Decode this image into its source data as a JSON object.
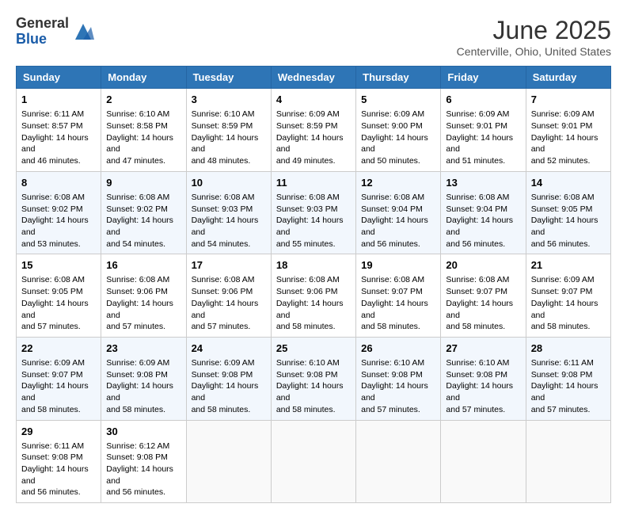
{
  "logo": {
    "general": "General",
    "blue": "Blue"
  },
  "title": "June 2025",
  "location": "Centerville, Ohio, United States",
  "weekdays": [
    "Sunday",
    "Monday",
    "Tuesday",
    "Wednesday",
    "Thursday",
    "Friday",
    "Saturday"
  ],
  "weeks": [
    [
      {
        "day": "1",
        "sunrise": "6:11 AM",
        "sunset": "8:57 PM",
        "daylight": "14 hours and 46 minutes."
      },
      {
        "day": "2",
        "sunrise": "6:10 AM",
        "sunset": "8:58 PM",
        "daylight": "14 hours and 47 minutes."
      },
      {
        "day": "3",
        "sunrise": "6:10 AM",
        "sunset": "8:59 PM",
        "daylight": "14 hours and 48 minutes."
      },
      {
        "day": "4",
        "sunrise": "6:09 AM",
        "sunset": "8:59 PM",
        "daylight": "14 hours and 49 minutes."
      },
      {
        "day": "5",
        "sunrise": "6:09 AM",
        "sunset": "9:00 PM",
        "daylight": "14 hours and 50 minutes."
      },
      {
        "day": "6",
        "sunrise": "6:09 AM",
        "sunset": "9:01 PM",
        "daylight": "14 hours and 51 minutes."
      },
      {
        "day": "7",
        "sunrise": "6:09 AM",
        "sunset": "9:01 PM",
        "daylight": "14 hours and 52 minutes."
      }
    ],
    [
      {
        "day": "8",
        "sunrise": "6:08 AM",
        "sunset": "9:02 PM",
        "daylight": "14 hours and 53 minutes."
      },
      {
        "day": "9",
        "sunrise": "6:08 AM",
        "sunset": "9:02 PM",
        "daylight": "14 hours and 54 minutes."
      },
      {
        "day": "10",
        "sunrise": "6:08 AM",
        "sunset": "9:03 PM",
        "daylight": "14 hours and 54 minutes."
      },
      {
        "day": "11",
        "sunrise": "6:08 AM",
        "sunset": "9:03 PM",
        "daylight": "14 hours and 55 minutes."
      },
      {
        "day": "12",
        "sunrise": "6:08 AM",
        "sunset": "9:04 PM",
        "daylight": "14 hours and 56 minutes."
      },
      {
        "day": "13",
        "sunrise": "6:08 AM",
        "sunset": "9:04 PM",
        "daylight": "14 hours and 56 minutes."
      },
      {
        "day": "14",
        "sunrise": "6:08 AM",
        "sunset": "9:05 PM",
        "daylight": "14 hours and 56 minutes."
      }
    ],
    [
      {
        "day": "15",
        "sunrise": "6:08 AM",
        "sunset": "9:05 PM",
        "daylight": "14 hours and 57 minutes."
      },
      {
        "day": "16",
        "sunrise": "6:08 AM",
        "sunset": "9:06 PM",
        "daylight": "14 hours and 57 minutes."
      },
      {
        "day": "17",
        "sunrise": "6:08 AM",
        "sunset": "9:06 PM",
        "daylight": "14 hours and 57 minutes."
      },
      {
        "day": "18",
        "sunrise": "6:08 AM",
        "sunset": "9:06 PM",
        "daylight": "14 hours and 58 minutes."
      },
      {
        "day": "19",
        "sunrise": "6:08 AM",
        "sunset": "9:07 PM",
        "daylight": "14 hours and 58 minutes."
      },
      {
        "day": "20",
        "sunrise": "6:08 AM",
        "sunset": "9:07 PM",
        "daylight": "14 hours and 58 minutes."
      },
      {
        "day": "21",
        "sunrise": "6:09 AM",
        "sunset": "9:07 PM",
        "daylight": "14 hours and 58 minutes."
      }
    ],
    [
      {
        "day": "22",
        "sunrise": "6:09 AM",
        "sunset": "9:07 PM",
        "daylight": "14 hours and 58 minutes."
      },
      {
        "day": "23",
        "sunrise": "6:09 AM",
        "sunset": "9:08 PM",
        "daylight": "14 hours and 58 minutes."
      },
      {
        "day": "24",
        "sunrise": "6:09 AM",
        "sunset": "9:08 PM",
        "daylight": "14 hours and 58 minutes."
      },
      {
        "day": "25",
        "sunrise": "6:10 AM",
        "sunset": "9:08 PM",
        "daylight": "14 hours and 58 minutes."
      },
      {
        "day": "26",
        "sunrise": "6:10 AM",
        "sunset": "9:08 PM",
        "daylight": "14 hours and 57 minutes."
      },
      {
        "day": "27",
        "sunrise": "6:10 AM",
        "sunset": "9:08 PM",
        "daylight": "14 hours and 57 minutes."
      },
      {
        "day": "28",
        "sunrise": "6:11 AM",
        "sunset": "9:08 PM",
        "daylight": "14 hours and 57 minutes."
      }
    ],
    [
      {
        "day": "29",
        "sunrise": "6:11 AM",
        "sunset": "9:08 PM",
        "daylight": "14 hours and 56 minutes."
      },
      {
        "day": "30",
        "sunrise": "6:12 AM",
        "sunset": "9:08 PM",
        "daylight": "14 hours and 56 minutes."
      },
      null,
      null,
      null,
      null,
      null
    ]
  ],
  "labels": {
    "sunrise": "Sunrise:",
    "sunset": "Sunset:",
    "daylight": "Daylight:"
  }
}
